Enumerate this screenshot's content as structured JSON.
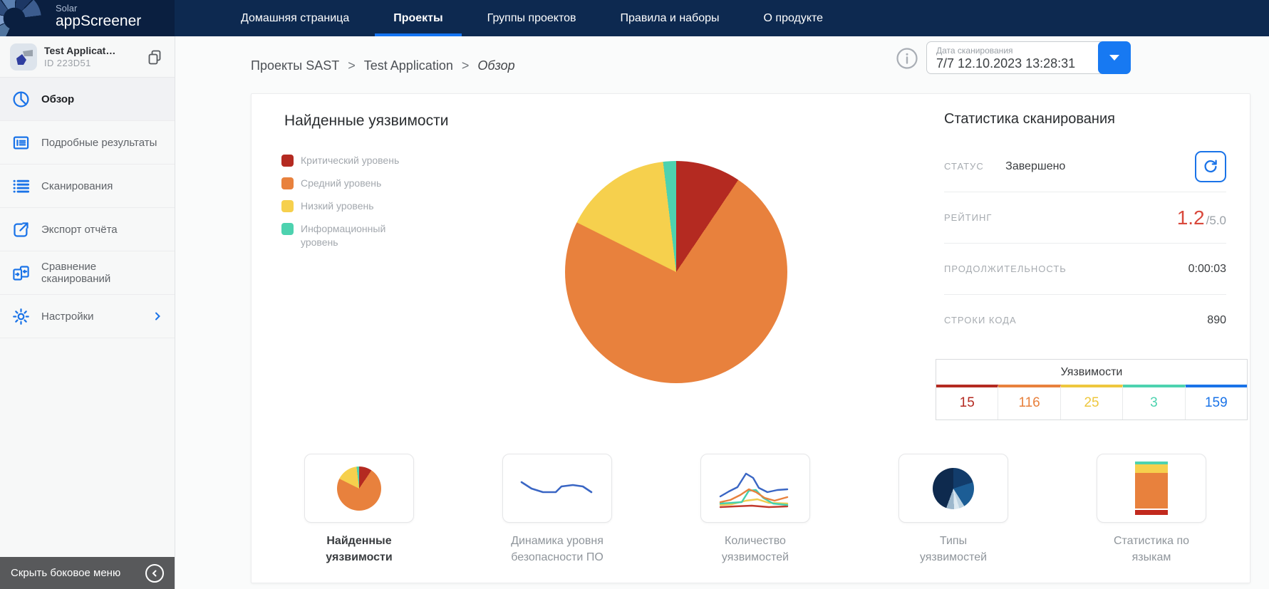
{
  "topnav": {
    "logo": {
      "line1": "Solar",
      "line2": "appScreener"
    },
    "items": [
      {
        "label": "Домашняя страница"
      },
      {
        "label": "Проекты"
      },
      {
        "label": "Группы проектов"
      },
      {
        "label": "Правила и наборы"
      },
      {
        "label": "О продукте"
      }
    ]
  },
  "sidebar": {
    "project": {
      "name": "Test Applicat…",
      "id": "ID 223D51"
    },
    "items": [
      {
        "label": "Обзор"
      },
      {
        "label": "Подробные результаты"
      },
      {
        "label": "Сканирования"
      },
      {
        "label": "Экспорт отчёта"
      },
      {
        "label": "Сравнение сканирований"
      },
      {
        "label": "Настройки"
      }
    ],
    "collapse_label": "Скрыть боковое меню"
  },
  "breadcrumb": {
    "separator": ">",
    "items": [
      "Проекты SAST",
      "Test Application",
      "Обзор"
    ]
  },
  "scan_date": {
    "label": "Дата сканирования",
    "value": "7/7 12.10.2023 13:28:31"
  },
  "chart_data": {
    "type": "pie",
    "title": "Найденные уязвимости",
    "categories": [
      "Критический уровень",
      "Средний уровень",
      "Низкий уровень",
      "Информационный уровень"
    ],
    "values": [
      15,
      116,
      25,
      3
    ],
    "colors": [
      "#b42a21",
      "#e8813d",
      "#f6d04d",
      "#4dd2af"
    ],
    "total": 159,
    "legend_position": "left",
    "start_angle_deg": 0,
    "direction": "clockwise"
  },
  "stats": {
    "title": "Статистика сканирования",
    "rows": [
      {
        "label": "СТАТУС",
        "value": "Завершено"
      },
      {
        "label": "РЕЙТИНГ",
        "value": "1.2",
        "suffix": "/5.0"
      },
      {
        "label": "ПРОДОЛЖИТЕЛЬНОСТЬ",
        "value": "0:00:03"
      },
      {
        "label": "СТРОКИ КОДА",
        "value": "890"
      }
    ],
    "rating_color": "#d9493c"
  },
  "vuln_table": {
    "title": "Уязвимости",
    "cells": [
      {
        "value": "15",
        "color": "#b42a21"
      },
      {
        "value": "116",
        "color": "#e8813d"
      },
      {
        "value": "25",
        "color": "#eec73e"
      },
      {
        "value": "3",
        "color": "#4dd2af"
      },
      {
        "value": "159",
        "color": "#1a73e8"
      }
    ]
  },
  "thumbnails": [
    {
      "line1": "Найденные",
      "line2": "уязвимости"
    },
    {
      "line1": "Динамика уровня",
      "line2": "безопасности ПО"
    },
    {
      "line1": "Количество",
      "line2": "уязвимостей"
    },
    {
      "line1": "Типы",
      "line2": "уязвимостей"
    },
    {
      "line1": "Статистика по",
      "line2": "языкам"
    }
  ]
}
